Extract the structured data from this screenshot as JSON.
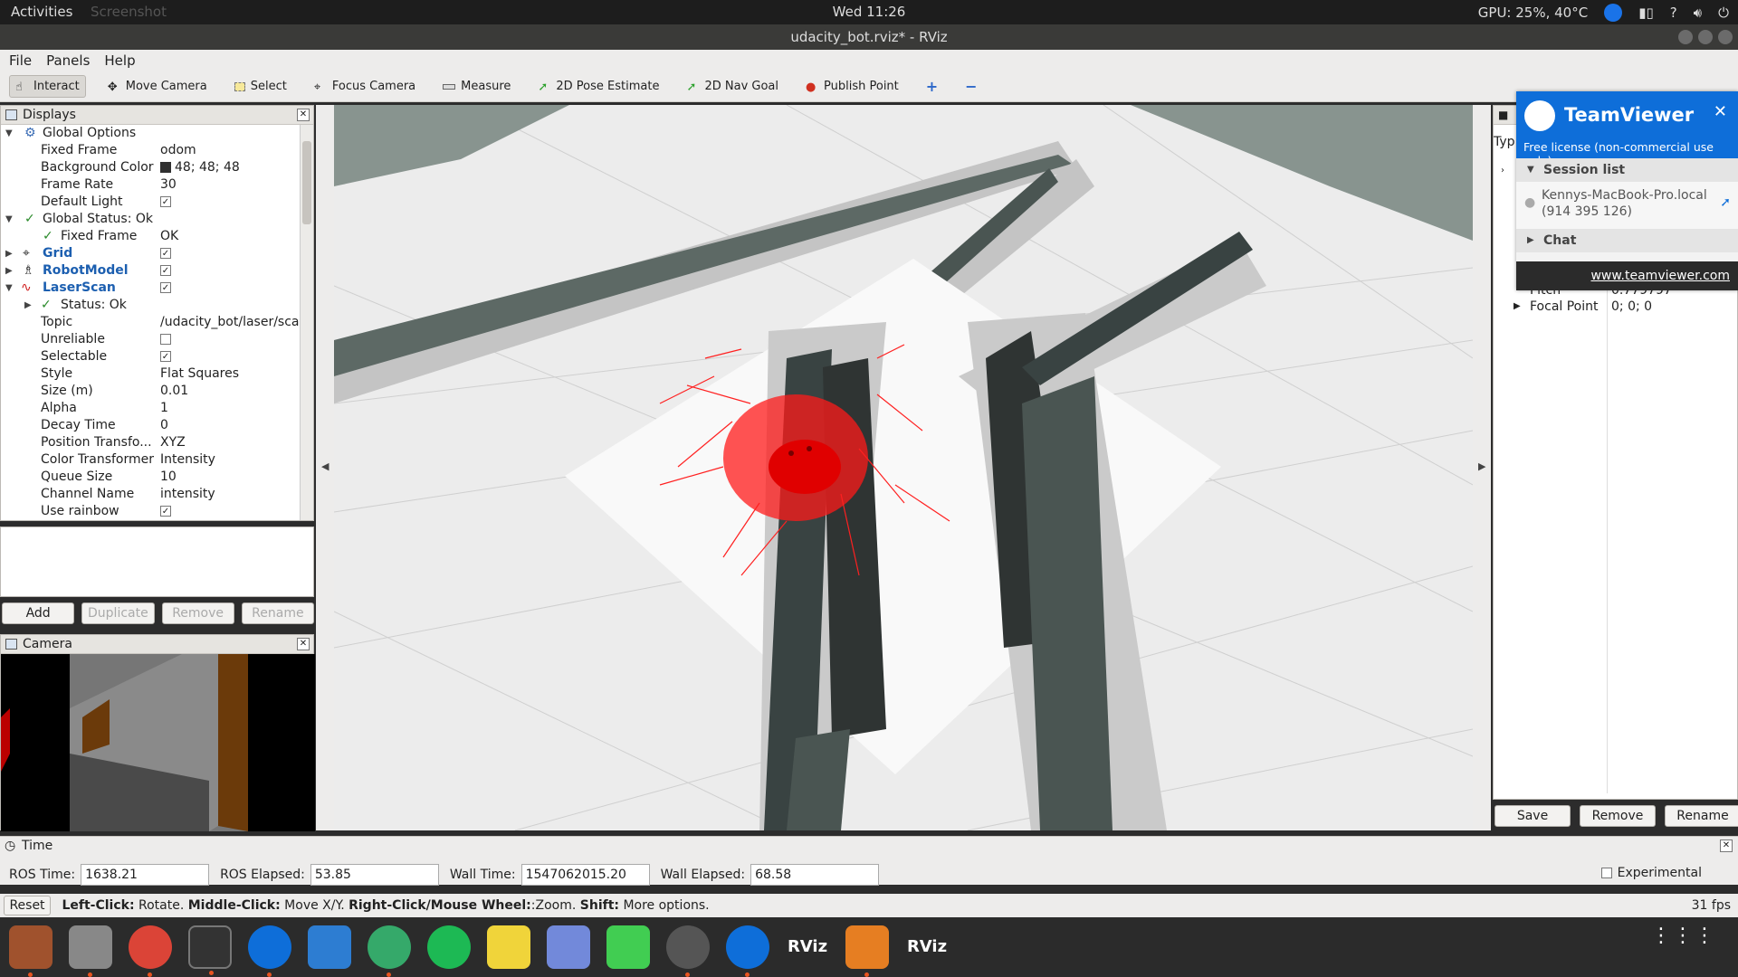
{
  "topbar": {
    "activities": "Activities",
    "app_menu": "Screenshot",
    "clock": "Wed 11:26",
    "gpu": "GPU: 25%, 40°C",
    "help": "?"
  },
  "window": {
    "title": "udacity_bot.rviz* - RViz"
  },
  "menu": {
    "file": "File",
    "panels": "Panels",
    "help": "Help"
  },
  "toolbar": {
    "interact": "Interact",
    "move_camera": "Move Camera",
    "select": "Select",
    "focus_camera": "Focus Camera",
    "measure": "Measure",
    "pose_estimate": "2D Pose Estimate",
    "nav_goal": "2D Nav Goal",
    "publish_point": "Publish Point",
    "plus": "+",
    "minus": "−"
  },
  "displays": {
    "title": "Displays",
    "rows": [
      {
        "key": "Global Options",
        "value": ""
      },
      {
        "key": "Fixed Frame",
        "value": "odom"
      },
      {
        "key": "Background Color",
        "value": "48; 48; 48"
      },
      {
        "key": "Frame Rate",
        "value": "30"
      },
      {
        "key": "Default Light",
        "value": "✓"
      },
      {
        "key": "Global Status: Ok",
        "value": ""
      },
      {
        "key": "Fixed Frame",
        "value": "OK"
      },
      {
        "key": "Grid",
        "value": "✓"
      },
      {
        "key": "RobotModel",
        "value": "✓"
      },
      {
        "key": "LaserScan",
        "value": "✓"
      },
      {
        "key": "Status: Ok",
        "value": ""
      },
      {
        "key": "Topic",
        "value": "/udacity_bot/laser/scan"
      },
      {
        "key": "Unreliable",
        "value": ""
      },
      {
        "key": "Selectable",
        "value": "✓"
      },
      {
        "key": "Style",
        "value": "Flat Squares"
      },
      {
        "key": "Size (m)",
        "value": "0.01"
      },
      {
        "key": "Alpha",
        "value": "1"
      },
      {
        "key": "Decay Time",
        "value": "0"
      },
      {
        "key": "Position Transfo...",
        "value": "XYZ"
      },
      {
        "key": "Color Transformer",
        "value": "Intensity"
      },
      {
        "key": "Queue Size",
        "value": "10"
      },
      {
        "key": "Channel Name",
        "value": "intensity"
      },
      {
        "key": "Use rainbow",
        "value": "✓"
      }
    ],
    "buttons": {
      "add": "Add",
      "duplicate": "Duplicate",
      "remove": "Remove",
      "rename": "Rename"
    }
  },
  "camera": {
    "title": "Camera"
  },
  "views": {
    "type_label": "Typ",
    "pitch_label": "Pitch",
    "pitch_value": "0.779797",
    "focal_label": "Focal Point",
    "focal_value": "0; 0; 0",
    "buttons": {
      "save": "Save",
      "remove": "Remove",
      "rename": "Rename"
    }
  },
  "teamviewer": {
    "name": "TeamViewer",
    "license": "Free license (non-commercial use only)",
    "session_list": "Session list",
    "session_host": "Kennys-MacBook-Pro.local",
    "session_id": "(914 395 126)",
    "chat": "Chat",
    "link": "www.teamviewer.com"
  },
  "time": {
    "title": "Time",
    "ros_time_label": "ROS Time:",
    "ros_time": "1638.21",
    "ros_elapsed_label": "ROS Elapsed:",
    "ros_elapsed": "53.85",
    "wall_time_label": "Wall Time:",
    "wall_time": "1547062015.20",
    "wall_elapsed_label": "Wall Elapsed:",
    "wall_elapsed": "68.58",
    "experimental": "Experimental"
  },
  "status": {
    "reset": "Reset",
    "left_click": "Left-Click:",
    "left_click_text": "Rotate.",
    "middle_click": "Middle-Click:",
    "middle_click_text": "Move X/Y.",
    "right_click": "Right-Click/Mouse Wheel:",
    "right_click_text": ":Zoom.",
    "shift": "Shift:",
    "shift_text": "More options.",
    "fps": "31 fps"
  },
  "dock": {
    "rviz1": "RViz",
    "rviz2": "RViz"
  }
}
